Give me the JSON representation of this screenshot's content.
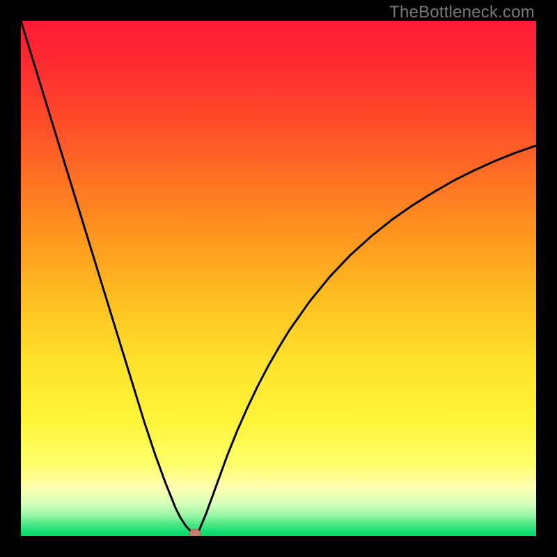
{
  "watermark": {
    "text": "TheBottleneck.com"
  },
  "colors": {
    "black": "#000000",
    "curve": "#000000",
    "marker_fill": "#c97c6f",
    "marker_stroke": "#b56a60",
    "gradient_stops": [
      {
        "offset": 0.0,
        "color": "#ff1a36"
      },
      {
        "offset": 0.1,
        "color": "#ff2f2f"
      },
      {
        "offset": 0.24,
        "color": "#ff5a27"
      },
      {
        "offset": 0.38,
        "color": "#ff8a1f"
      },
      {
        "offset": 0.52,
        "color": "#ffb820"
      },
      {
        "offset": 0.66,
        "color": "#ffe12c"
      },
      {
        "offset": 0.78,
        "color": "#fff53a"
      },
      {
        "offset": 0.86,
        "color": "#ffff6a"
      },
      {
        "offset": 0.905,
        "color": "#ffffb0"
      },
      {
        "offset": 0.935,
        "color": "#d8ffb8"
      },
      {
        "offset": 0.958,
        "color": "#9ff7a8"
      },
      {
        "offset": 0.975,
        "color": "#56e887"
      },
      {
        "offset": 0.99,
        "color": "#18df72"
      },
      {
        "offset": 1.0,
        "color": "#00d965"
      }
    ]
  },
  "chart_data": {
    "type": "line",
    "title": "",
    "xlabel": "",
    "ylabel": "",
    "xlim": [
      0,
      100
    ],
    "ylim": [
      0,
      100
    ],
    "grid": false,
    "legend": false,
    "x": [
      0,
      2,
      4,
      6,
      8,
      10,
      12,
      14,
      16,
      18,
      20,
      22,
      24,
      26,
      28,
      30,
      31,
      32,
      33,
      33.8,
      34.5,
      36,
      38,
      40,
      42,
      44,
      46,
      48,
      50,
      52,
      56,
      60,
      64,
      68,
      72,
      76,
      80,
      84,
      88,
      92,
      96,
      100
    ],
    "values": [
      100,
      93.5,
      87,
      80.5,
      74,
      67.5,
      61,
      54.5,
      48,
      41.5,
      35,
      28.5,
      22,
      16,
      10.5,
      5.5,
      3.5,
      2,
      0.9,
      0.2,
      0.9,
      4.5,
      10,
      15.5,
      20.5,
      25,
      29.2,
      33,
      36.5,
      39.8,
      45.5,
      50.4,
      54.6,
      58.2,
      61.4,
      64.2,
      66.7,
      69,
      71,
      72.8,
      74.4,
      75.8
    ],
    "marker": {
      "x": 33.8,
      "y": 0.5
    },
    "notes": "V-shaped bottleneck curve with minimum near x≈33.8. Left branch is near-linear; right branch rises with diminishing slope. Values estimated from pixels; y=0 at bottom, y=100 at top of plot area."
  }
}
